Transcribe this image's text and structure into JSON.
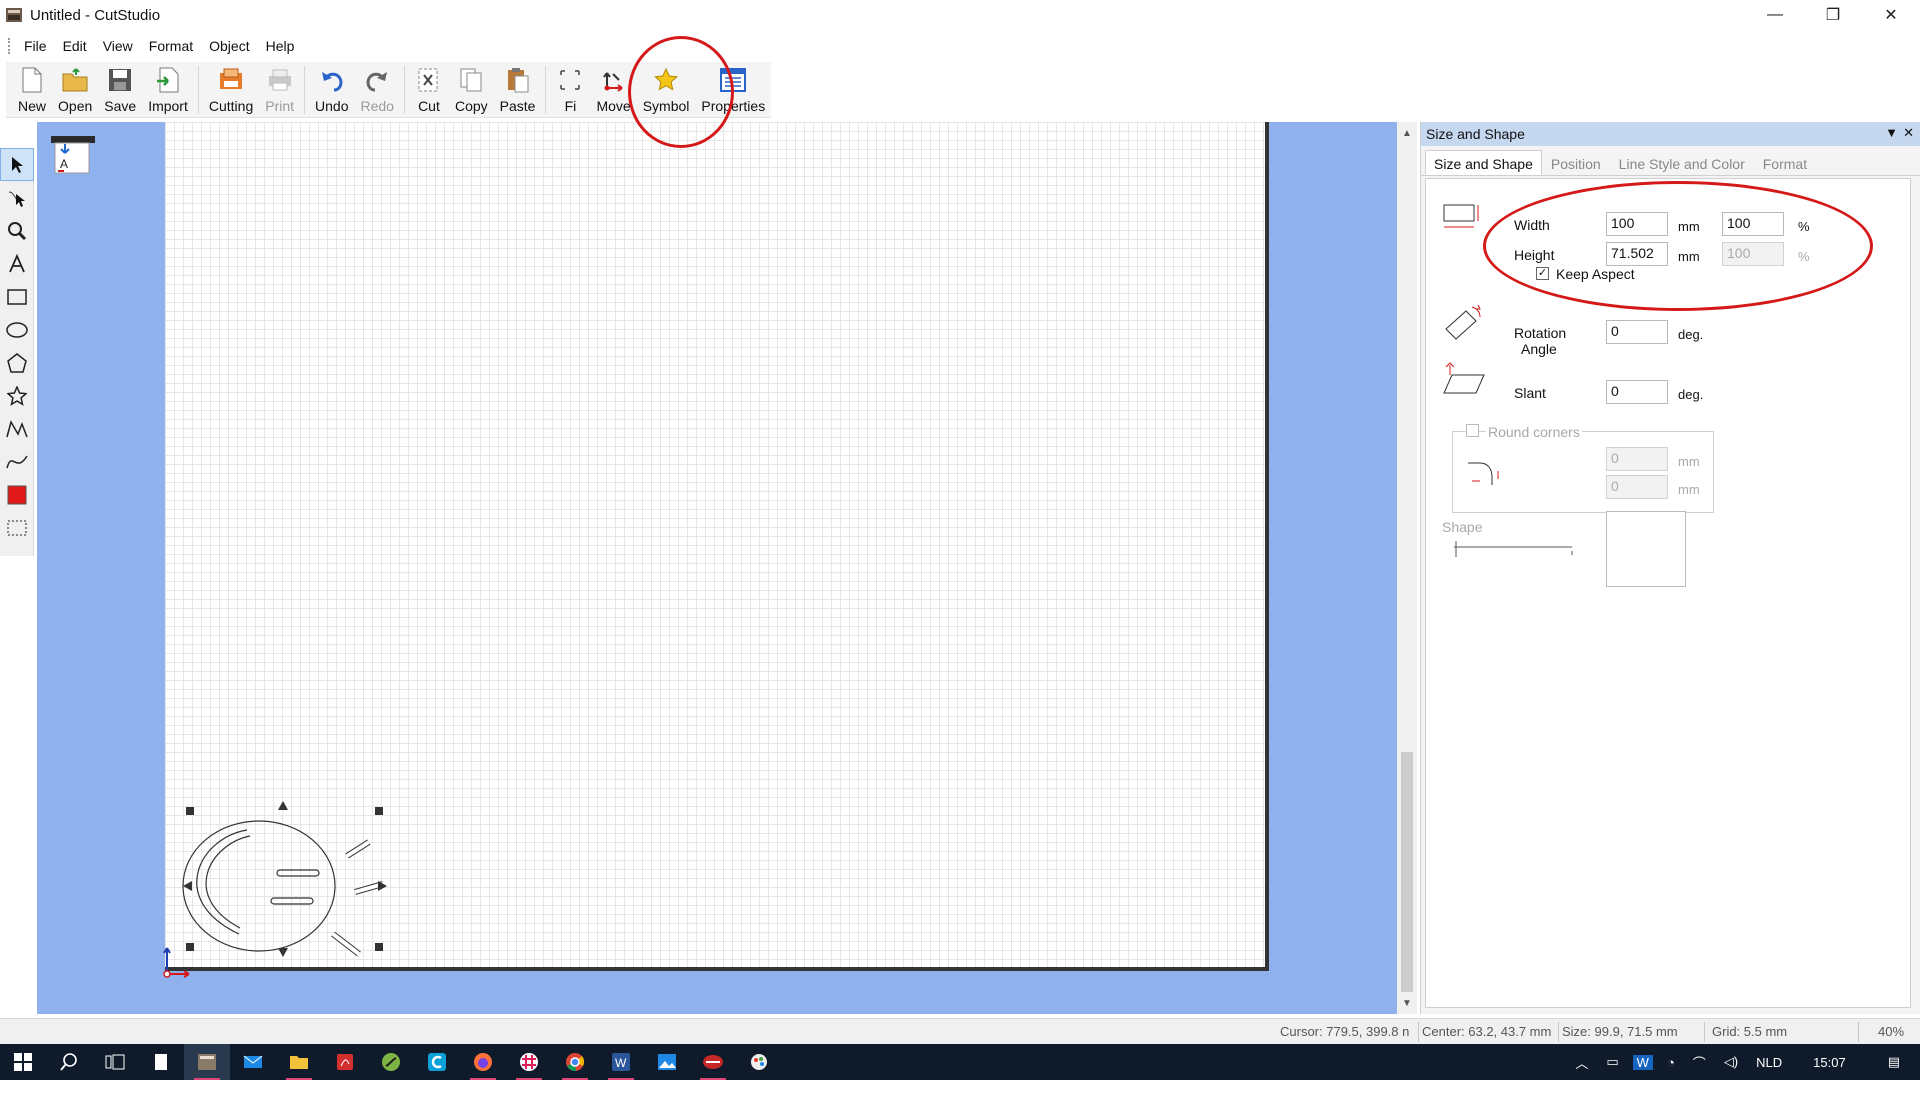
{
  "window": {
    "title": "Untitled - CutStudio",
    "min": "—",
    "max": "❐",
    "close": "✕"
  },
  "menu": [
    "File",
    "Edit",
    "View",
    "Format",
    "Object",
    "Help"
  ],
  "toolbar": [
    {
      "label": "New",
      "icon": "new-icon",
      "enabled": true
    },
    {
      "label": "Open",
      "icon": "open-folder-icon",
      "enabled": true
    },
    {
      "label": "Save",
      "icon": "save-disk-icon",
      "enabled": true
    },
    {
      "label": "Import",
      "icon": "import-icon",
      "enabled": true
    },
    {
      "label": "Cutting",
      "icon": "cutting-icon",
      "enabled": true
    },
    {
      "label": "Print",
      "icon": "print-icon",
      "enabled": false
    },
    {
      "label": "Undo",
      "icon": "undo-icon",
      "enabled": true
    },
    {
      "label": "Redo",
      "icon": "redo-icon",
      "enabled": false
    },
    {
      "label": "Cut",
      "icon": "cut-icon",
      "enabled": true
    },
    {
      "label": "Copy",
      "icon": "copy-icon",
      "enabled": true
    },
    {
      "label": "Paste",
      "icon": "paste-icon",
      "enabled": true
    },
    {
      "label": "Fi",
      "icon": "fit-icon",
      "enabled": true
    },
    {
      "label": "Move",
      "icon": "move-icon",
      "enabled": true
    },
    {
      "label": "Symbol",
      "icon": "star-symbol-icon",
      "enabled": true
    },
    {
      "label": "Properties",
      "icon": "properties-icon",
      "enabled": true
    }
  ],
  "panel": {
    "title": "Size and Shape",
    "tabs": [
      "Size and Shape",
      "Position",
      "Line Style and Color",
      "Format"
    ],
    "active_tab": 0,
    "width_label": "Width",
    "width_value": "100",
    "width_unit": "mm",
    "width_percent": "100",
    "percent_sign": "%",
    "height_label": "Height",
    "height_value": "71.502",
    "height_unit": "mm",
    "height_percent": "100",
    "keep_aspect_label": "Keep Aspect",
    "keep_aspect_checked": true,
    "rotation_label_1": "Rotation",
    "rotation_label_2": "Angle",
    "rotation_value": "0",
    "rotation_unit": "deg.",
    "slant_label": "Slant",
    "slant_value": "0",
    "slant_unit": "deg.",
    "round_corners_label": "Round corners",
    "round_value_1": "0",
    "round_value_2": "0",
    "round_unit": "mm",
    "shape_label": "Shape"
  },
  "status": {
    "cursor": "Cursor: 779.5, 399.8 n",
    "center": "Center: 63.2, 43.7 mm",
    "size": "Size: 99.9, 71.5 mm",
    "grid": "Grid: 5.5 mm",
    "zoom": "40%"
  },
  "taskbar": {
    "tray": {
      "lang": "NLD",
      "time": "15:07"
    }
  },
  "colors": {
    "accent": "#d51818",
    "canvas_bg": "#8fb2ee",
    "panel_header": "#c6d8ef"
  }
}
